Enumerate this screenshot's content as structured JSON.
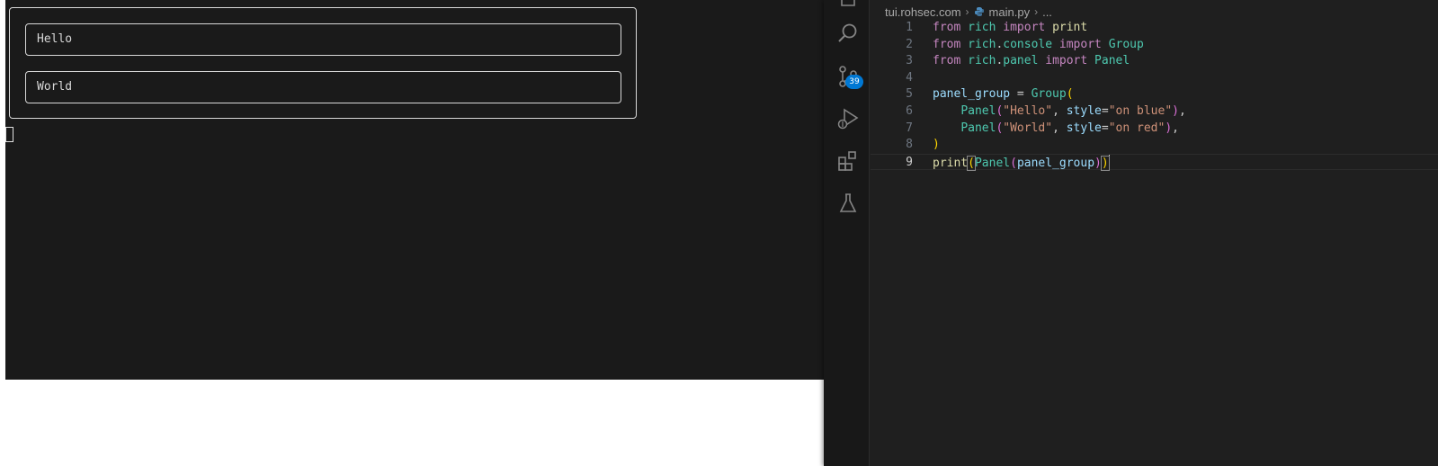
{
  "terminal": {
    "panels": [
      {
        "label": "Hello"
      },
      {
        "label": "World"
      }
    ]
  },
  "activity_bar": {
    "icons": [
      "search-icon",
      "source-control-icon",
      "run-debug-icon",
      "extensions-icon",
      "testing-icon"
    ],
    "source_control_badge": "39",
    "badge_color": "#0078d4"
  },
  "editor": {
    "breadcrumb": {
      "folder": "tui.rohsec.com",
      "file": "main.py",
      "symbol": "..."
    },
    "current_line": 9,
    "lines": [
      {
        "n": "1",
        "tokens": [
          [
            "kw",
            "from"
          ],
          [
            "pn",
            " "
          ],
          [
            "mod",
            "rich"
          ],
          [
            "pn",
            " "
          ],
          [
            "kw",
            "import"
          ],
          [
            "pn",
            " "
          ],
          [
            "fn",
            "print"
          ]
        ]
      },
      {
        "n": "2",
        "tokens": [
          [
            "kw",
            "from"
          ],
          [
            "pn",
            " "
          ],
          [
            "mod",
            "rich"
          ],
          [
            "pn",
            "."
          ],
          [
            "mod",
            "console"
          ],
          [
            "pn",
            " "
          ],
          [
            "kw",
            "import"
          ],
          [
            "pn",
            " "
          ],
          [
            "cls",
            "Group"
          ]
        ]
      },
      {
        "n": "3",
        "tokens": [
          [
            "kw",
            "from"
          ],
          [
            "pn",
            " "
          ],
          [
            "mod",
            "rich"
          ],
          [
            "pn",
            "."
          ],
          [
            "mod",
            "panel"
          ],
          [
            "pn",
            " "
          ],
          [
            "kw",
            "import"
          ],
          [
            "pn",
            " "
          ],
          [
            "cls",
            "Panel"
          ]
        ]
      },
      {
        "n": "4",
        "tokens": []
      },
      {
        "n": "5",
        "tokens": [
          [
            "var",
            "panel_group"
          ],
          [
            "pn",
            " = "
          ],
          [
            "cls",
            "Group"
          ],
          [
            "br1",
            "("
          ]
        ]
      },
      {
        "n": "6",
        "tokens": [
          [
            "pn",
            "    "
          ],
          [
            "cls",
            "Panel"
          ],
          [
            "br2",
            "("
          ],
          [
            "str",
            "\"Hello\""
          ],
          [
            "pn",
            ", "
          ],
          [
            "var",
            "style"
          ],
          [
            "pn",
            "="
          ],
          [
            "str",
            "\"on blue\""
          ],
          [
            "br2",
            ")"
          ],
          [
            "pn",
            ","
          ]
        ]
      },
      {
        "n": "7",
        "tokens": [
          [
            "pn",
            "    "
          ],
          [
            "cls",
            "Panel"
          ],
          [
            "br2",
            "("
          ],
          [
            "str",
            "\"World\""
          ],
          [
            "pn",
            ", "
          ],
          [
            "var",
            "style"
          ],
          [
            "pn",
            "="
          ],
          [
            "str",
            "\"on red\""
          ],
          [
            "br2",
            ")"
          ],
          [
            "pn",
            ","
          ]
        ]
      },
      {
        "n": "8",
        "tokens": [
          [
            "br1",
            ")"
          ]
        ]
      },
      {
        "n": "9",
        "tokens": [
          [
            "fn",
            "print"
          ],
          [
            "br1",
            "(",
            "match"
          ],
          [
            "cls",
            "Panel"
          ],
          [
            "br2",
            "("
          ],
          [
            "var",
            "panel_group"
          ],
          [
            "br2",
            ")"
          ],
          [
            "br1",
            ")",
            "match"
          ],
          [
            "cursor",
            ""
          ]
        ]
      }
    ]
  },
  "colors": {
    "terminal_bg": "#1a1a1a",
    "editor_bg": "#1f1f1f",
    "activity_bar_bg": "#181818"
  }
}
